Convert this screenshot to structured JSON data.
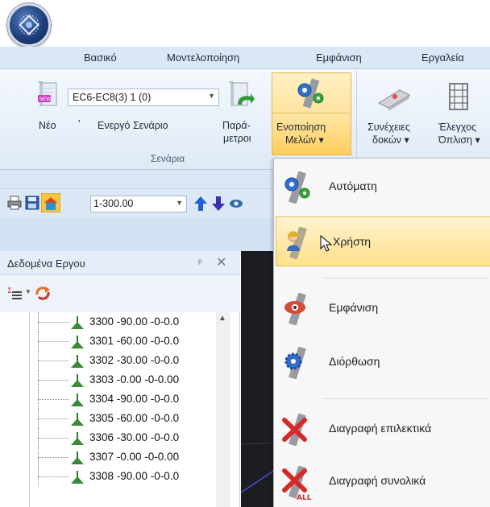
{
  "ribbon_tabs": [
    "Βασικό",
    "Μοντελοποίηση",
    "Εμφάνιση",
    "Εργαλεία"
  ],
  "ribbon": {
    "new_label": "Νέο",
    "scenario_combo_value": "EC6-EC8(3) 1 (0)",
    "active_scenario_label": "Ενεργό Σενάριο",
    "params_label_1": "Παρά-",
    "params_label_2": "μετροι",
    "unify_label_1": "Ενοποίηση",
    "unify_label_2": "Μελών ▾",
    "beams_label_1": "Συνέχειες",
    "beams_label_2": "δοκών ▾",
    "check_label_1": "Έλεγχος",
    "check_label_2": "Όπλιση ▾",
    "group_label": "Σενάρια",
    "quote_mark": "'"
  },
  "toolbar": {
    "level_value": "1-300.00"
  },
  "panel": {
    "title": "Δεδομένα Εργου",
    "pin": "ᵖ",
    "close": "✕",
    "rows": [
      "3300 -90.00 -0-0.0",
      "3301 -60.00 -0-0.0",
      "3302 -30.00 -0-0.0",
      "3303 -0.00 -0-0.00",
      "3304 -90.00 -0-0.0",
      "3305 -60.00 -0-0.0",
      "3306 -30.00 -0-0.0",
      "3307 -0.00 -0-0.00",
      "3308 -90.00 -0-0.0"
    ]
  },
  "menu": {
    "items": [
      "Αυτόματη",
      "Χρήστη",
      "Εμφάνιση",
      "Διόρθωση",
      "Διαγραφή επιλεκτικά",
      "Διαγραφή συνολικά"
    ],
    "active_index": 1
  },
  "colors": {
    "accent_yellow": "#ffd77a",
    "ribbon_blue": "#d9e7f6",
    "toolbar_blue": "#dce8f5"
  }
}
